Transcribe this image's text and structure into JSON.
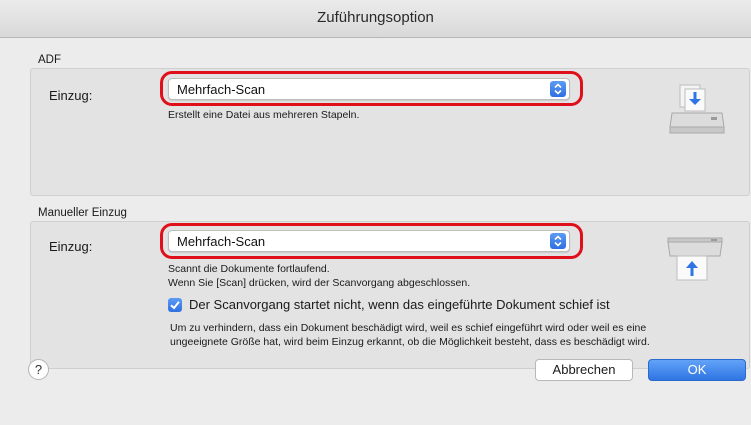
{
  "window": {
    "title": "Zuführungsoption"
  },
  "adf": {
    "section_label": "ADF",
    "field_label": "Einzug:",
    "select_value": "Mehrfach-Scan",
    "description": "Erstellt eine Datei aus mehreren Stapeln.",
    "icon": "adf-scanner-icon"
  },
  "manual": {
    "section_label": "Manueller Einzug",
    "field_label": "Einzug:",
    "select_value": "Mehrfach-Scan",
    "description_line1": "Scannt die Dokumente fortlaufend.",
    "description_line2": "Wenn Sie [Scan] drücken, wird der Scanvorgang abgeschlossen.",
    "checkbox_checked": true,
    "checkbox_label": "Der Scanvorgang startet nicht, wenn das eingeführte Dokument schief ist",
    "note_line1": "Um zu verhindern, dass ein Dokument beschädigt wird, weil es schief eingeführt wird oder weil es eine",
    "note_line2": "ungeeignete Größe hat, wird beim Einzug erkannt, ob die Möglichkeit besteht, dass es beschädigt wird.",
    "icon": "manual-feed-scanner-icon"
  },
  "footer": {
    "help_label": "?",
    "cancel_label": "Abbrechen",
    "ok_label": "OK"
  },
  "colors": {
    "highlight": "#e0101a",
    "accent": "#2f74e4"
  }
}
